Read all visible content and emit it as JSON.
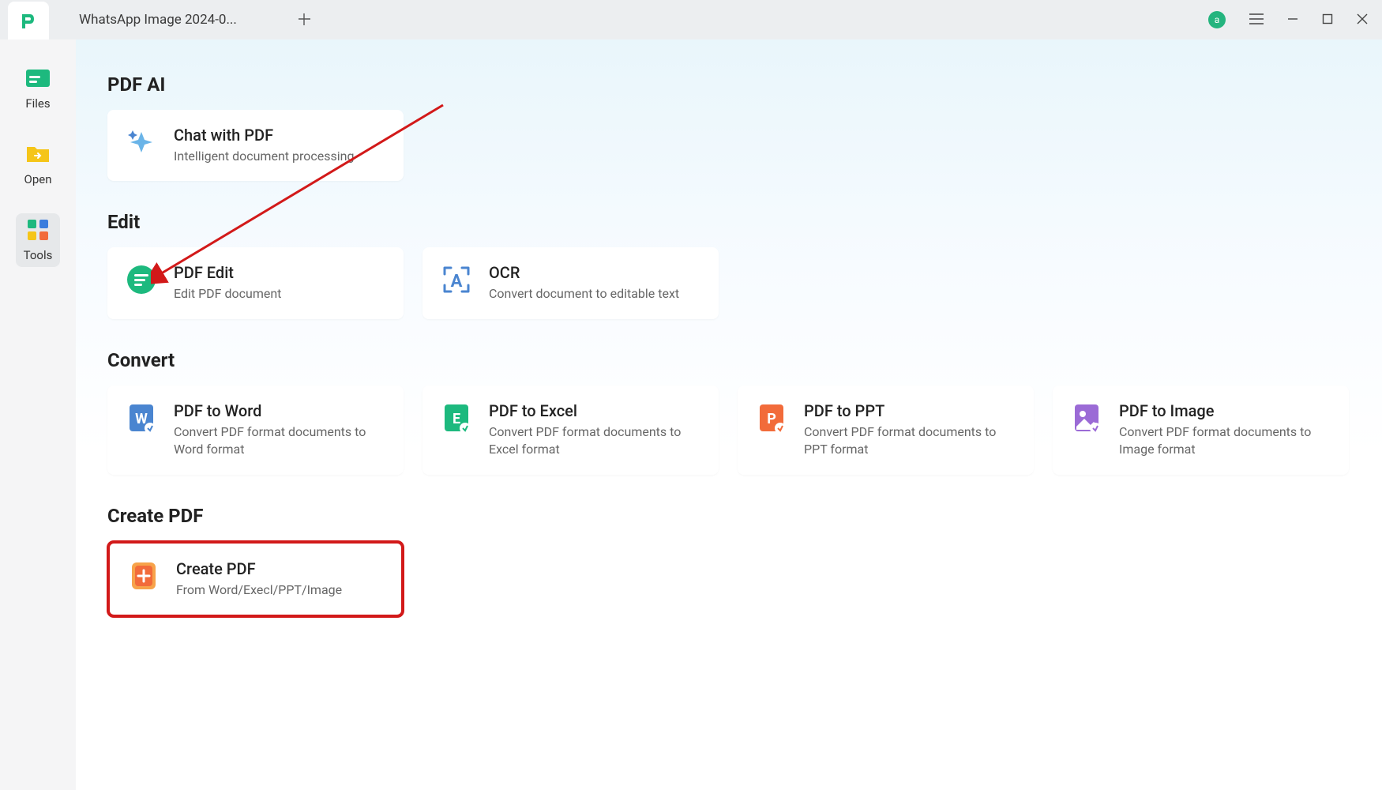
{
  "titlebar": {
    "tab_name": "WhatsApp Image 2024-0...",
    "avatar_initial": "a"
  },
  "sidebar": {
    "files": "Files",
    "open": "Open",
    "tools": "Tools"
  },
  "sections": {
    "pdf_ai": {
      "title": "PDF AI",
      "chat_with_pdf": {
        "title": "Chat with PDF",
        "desc": "Intelligent document processing"
      }
    },
    "edit": {
      "title": "Edit",
      "pdf_edit": {
        "title": "PDF Edit",
        "desc": "Edit PDF document"
      },
      "ocr": {
        "title": "OCR",
        "desc": "Convert document to editable text"
      }
    },
    "convert": {
      "title": "Convert",
      "pdf_to_word": {
        "title": "PDF to Word",
        "desc": "Convert PDF format documents to Word format"
      },
      "pdf_to_excel": {
        "title": "PDF to Excel",
        "desc": "Convert PDF format documents to Excel format"
      },
      "pdf_to_ppt": {
        "title": "PDF to PPT",
        "desc": "Convert PDF format documents to PPT format"
      },
      "pdf_to_image": {
        "title": "PDF to Image",
        "desc": "Convert PDF format documents to Image format"
      }
    },
    "create_pdf": {
      "title": "Create PDF",
      "create": {
        "title": "Create PDF",
        "desc": "From Word/Execl/PPT/Image"
      }
    }
  }
}
